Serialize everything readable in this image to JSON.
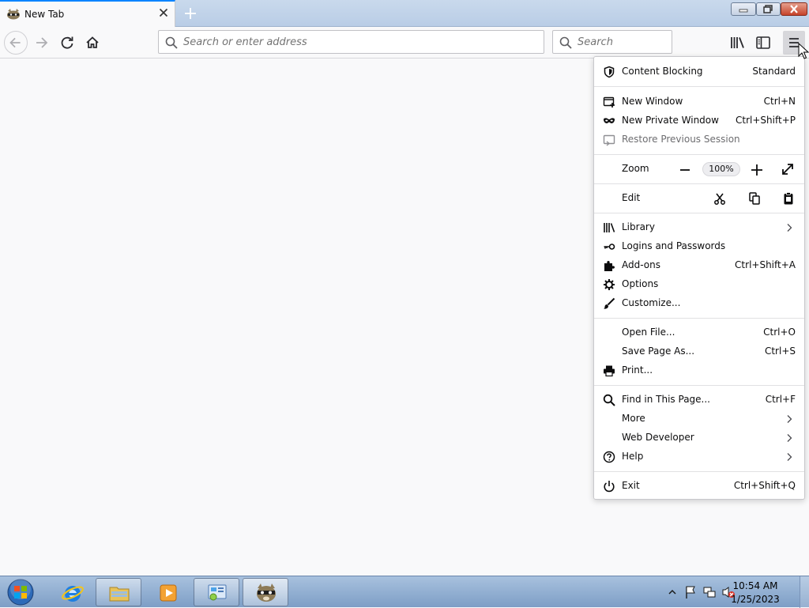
{
  "tab": {
    "title": "New Tab"
  },
  "navbar": {
    "url_placeholder": "Search or enter address",
    "search_placeholder": "Search"
  },
  "menu": {
    "content_blocking": {
      "label": "Content Blocking",
      "value": "Standard"
    },
    "new_window": {
      "label": "New Window",
      "shortcut": "Ctrl+N"
    },
    "new_private_window": {
      "label": "New Private Window",
      "shortcut": "Ctrl+Shift+P"
    },
    "restore_session": {
      "label": "Restore Previous Session"
    },
    "zoom": {
      "label": "Zoom",
      "level": "100%"
    },
    "edit": {
      "label": "Edit"
    },
    "library": {
      "label": "Library"
    },
    "logins": {
      "label": "Logins and Passwords"
    },
    "addons": {
      "label": "Add-ons",
      "shortcut": "Ctrl+Shift+A"
    },
    "options": {
      "label": "Options"
    },
    "customize": {
      "label": "Customize..."
    },
    "open_file": {
      "label": "Open File...",
      "shortcut": "Ctrl+O"
    },
    "save_page": {
      "label": "Save Page As...",
      "shortcut": "Ctrl+S"
    },
    "print": {
      "label": "Print..."
    },
    "find": {
      "label": "Find in This Page...",
      "shortcut": "Ctrl+F"
    },
    "more": {
      "label": "More"
    },
    "web_developer": {
      "label": "Web Developer"
    },
    "help": {
      "label": "Help"
    },
    "exit": {
      "label": "Exit",
      "shortcut": "Ctrl+Shift+Q"
    }
  },
  "taskbar": {
    "time": "10:54 AM",
    "date": "1/25/2023"
  },
  "icons": {
    "menu_icons": [
      "shield-icon",
      "new-window-icon",
      "mask-icon",
      "restore-icon",
      "library-icon",
      "key-icon",
      "puzzle-icon",
      "gear-icon",
      "brush-icon",
      "printer-icon",
      "search-icon",
      "help-icon",
      "power-icon"
    ]
  },
  "colors": {
    "accent": "#0a84ff",
    "panel_bg": "#ffffff",
    "toolbar_bg": "#f9f9fa"
  }
}
